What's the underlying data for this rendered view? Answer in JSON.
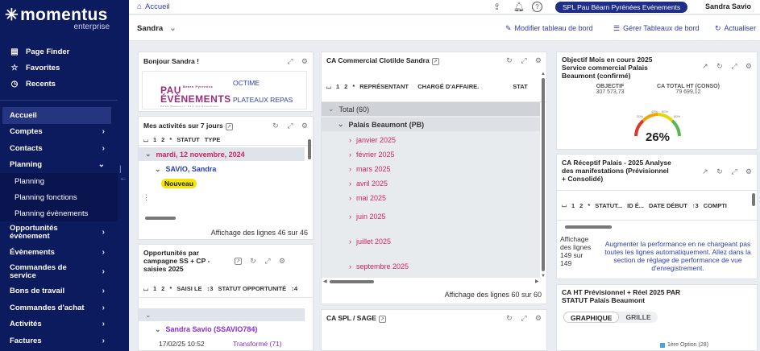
{
  "brand": {
    "name": "momentus",
    "sub": "enterprise"
  },
  "sidebar": {
    "top_links": [
      {
        "label": "Page Finder",
        "icon": "page-icon"
      },
      {
        "label": "Favorites",
        "icon": "star-icon"
      },
      {
        "label": "Recents",
        "icon": "clock-icon"
      }
    ],
    "nav": [
      {
        "label": "Accueil"
      },
      {
        "label": "Comptes"
      },
      {
        "label": "Contacts"
      },
      {
        "label": "Planning"
      },
      {
        "label": "Planning",
        "sub": true
      },
      {
        "label": "Planning fonctions",
        "sub": true
      },
      {
        "label": "Planning évènements",
        "sub": true
      },
      {
        "label": "Opportunités évènement"
      },
      {
        "label": "Évènements"
      },
      {
        "label": "Commandes de service"
      },
      {
        "label": "Bons de travail"
      },
      {
        "label": "Commandes d'achat"
      },
      {
        "label": "Activités"
      },
      {
        "label": "Factures"
      }
    ]
  },
  "topbar": {
    "home": "Accueil",
    "company": "SPL Pau Béarn Pyrénées Evénements",
    "user": "Sandra Savio"
  },
  "subbar": {
    "dashboard": "Sandra",
    "edit": "Modifier tableau de bord",
    "manage": "Gérer Tableaux de bord",
    "refresh": "Actualiser"
  },
  "p1": {
    "title": "Bonjour Sandra !",
    "logo_l1": "PAU",
    "logo_tag": "Béarn Pyrénées",
    "logo_l2": "ÉVÈNEMENTS",
    "logo_l3": "Palais Beaumont / Parc des Expositions",
    "link1": "OCTIME",
    "link2": "PLATEAUX REPAS"
  },
  "p2": {
    "title": "Mes activités sur 7 jours",
    "cols": [
      "1",
      "2",
      "*",
      "STATUT",
      "TYPE"
    ],
    "date": "mardi, 12 novembre, 2024",
    "person": "SAVIO, Sandra",
    "badge": "Nouveau",
    "footer": "Affichage des lignes 46 sur 46"
  },
  "p3": {
    "title": "Opportunités par campagne SS + CP - saisies 2025",
    "cols": [
      "1",
      "2",
      "*",
      "SAISI LE",
      "↕3",
      "STATUT OPPORTUNITÉ",
      "↕4"
    ],
    "person": "Sandra Savio (SSAVIO784)",
    "row_date": "17/02/25 10:52",
    "row_status": "Transformé (71)"
  },
  "p4": {
    "title": "CA Commercial Clotilde Sandra",
    "cols": [
      "1",
      "2",
      "*",
      "REPRÉSENTANT",
      "CHARGÉ D'AFFAIRE.",
      "STAT"
    ],
    "total": "Total (60)",
    "palais": "Palais Beaumont (PB)",
    "months": [
      "janvier 2025",
      "février 2025",
      "mars 2025",
      "avril 2025",
      "mai 2025",
      "juin 2025",
      "juillet 2025",
      "septembre 2025"
    ],
    "footer": "Affichage des lignes 60 sur 60"
  },
  "p5": {
    "title": "CA SPL / SAGE"
  },
  "p6": {
    "title": "Objectif Mois en cours 2025 Service commercial Palais Beaumont (confirmé)",
    "objectif_label": "OBJECTIF",
    "objectif_value": "307 573,73",
    "total_label": "CA TOTAL HT (CONSO)",
    "total_value": "79 699,12",
    "percent": "26%",
    "percent_value": 26,
    "gauge_ticks": [
      "20%",
      "40%",
      "60%",
      "80%"
    ]
  },
  "p7": {
    "title": "CA Réceptif Palais - 2025 Analyse des manifestations (Prévisionnel + Consolidé)",
    "cols": [
      "1",
      "2",
      "*",
      "STATUT...",
      "ID É...",
      "DATE DÉBUT",
      "↑3",
      "COMPTI"
    ],
    "left_text": "Affichage des lignes 149 sur 149",
    "message": "Augmenter la performance en ne chargeant pas toutes les lignes automatiquement. Allez dans la section de réglage de performance de vue d'enregistrement."
  },
  "p8": {
    "title": "CA HT Prévisionnel + Réel 2025 PAR STATUT Palais Beaumont",
    "tab1": "GRAPHIQUE",
    "tab2": "GRILLE",
    "legend": "1ère Option (28)"
  },
  "colors": {
    "navy": "#0c1a5e",
    "link": "#2b3eb1",
    "pink": "#d0245f",
    "purple": "#8a2be2",
    "badge": "#f5e600"
  }
}
